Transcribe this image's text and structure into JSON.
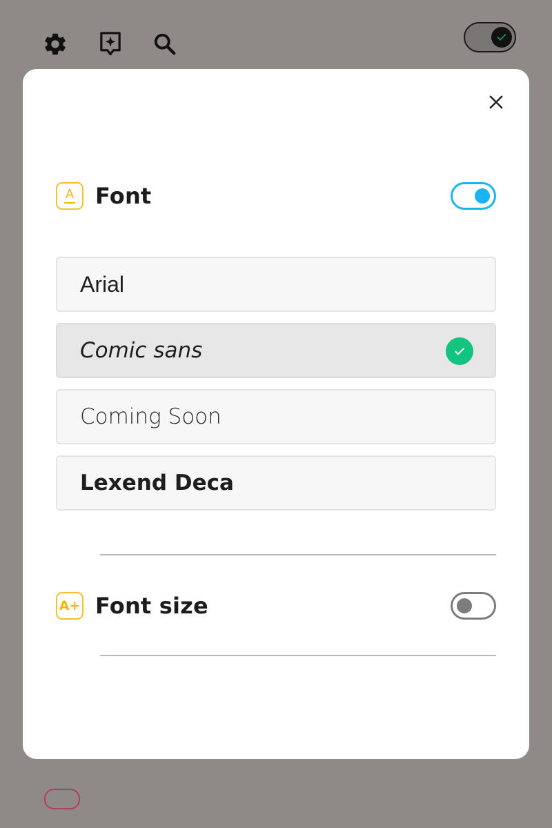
{
  "toolbar": {
    "settings_icon": "gear-icon",
    "assistant_icon": "sparkle-bubble-icon",
    "search_icon": "search-icon",
    "toggle": {
      "state": "on"
    }
  },
  "dialog": {
    "close_icon": "close-icon",
    "font_section": {
      "badge_text": "A",
      "title": "Font",
      "toggle_on": true,
      "options": [
        {
          "label": "Arial",
          "selected": false
        },
        {
          "label": "Comic sans",
          "selected": true
        },
        {
          "label": "Coming Soon",
          "selected": false
        },
        {
          "label": "Lexend Deca",
          "selected": false
        }
      ]
    },
    "font_size_section": {
      "badge_text": "A+",
      "title": "Font size",
      "toggle_on": false
    }
  },
  "colors": {
    "accent_blue": "#1ab3f4",
    "badge_yellow": "#f5c22b",
    "check_green": "#13c380",
    "overlay": "#8f8a87"
  }
}
